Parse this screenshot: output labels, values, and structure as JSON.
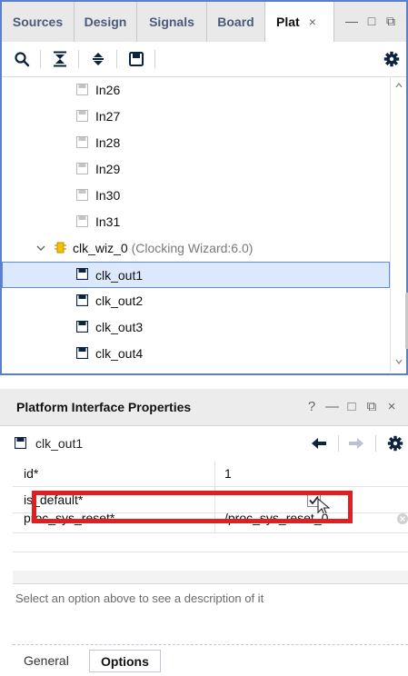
{
  "top_panel": {
    "tabs": [
      {
        "label": "Sources",
        "active": false
      },
      {
        "label": "Design",
        "active": false
      },
      {
        "label": "Signals",
        "active": false
      },
      {
        "label": "Board",
        "active": false
      },
      {
        "label": "Plat",
        "active": true
      }
    ],
    "tab_close_glyph": "×",
    "window_buttons": {
      "minimize": "—",
      "maximize": "□",
      "restore": "⧉"
    },
    "toolbar": {
      "icons": [
        "search-icon",
        "collapse-all-icon",
        "expand-all-icon",
        "save-icon",
        "settings-gear-icon"
      ]
    },
    "tree": {
      "rows": [
        {
          "label": "In26",
          "sublabel": "",
          "icon": "port-icon",
          "indent": 2,
          "selected": false
        },
        {
          "label": "In27",
          "sublabel": "",
          "icon": "port-icon",
          "indent": 2,
          "selected": false
        },
        {
          "label": "In28",
          "sublabel": "",
          "icon": "port-icon",
          "indent": 2,
          "selected": false
        },
        {
          "label": "In29",
          "sublabel": "",
          "icon": "port-icon",
          "indent": 2,
          "selected": false
        },
        {
          "label": "In30",
          "sublabel": "",
          "icon": "port-icon",
          "indent": 2,
          "selected": false
        },
        {
          "label": "In31",
          "sublabel": "",
          "icon": "port-icon",
          "indent": 2,
          "selected": false
        },
        {
          "label": "clk_wiz_0",
          "sublabel": "(Clocking Wizard:6.0)",
          "icon": "ip-block-icon",
          "indent": 1,
          "selected": false,
          "expanded": true
        },
        {
          "label": "clk_out1",
          "sublabel": "",
          "icon": "clock-port-icon",
          "indent": 2,
          "selected": true
        },
        {
          "label": "clk_out2",
          "sublabel": "",
          "icon": "clock-port-icon",
          "indent": 2,
          "selected": false
        },
        {
          "label": "clk_out3",
          "sublabel": "",
          "icon": "clock-port-icon",
          "indent": 2,
          "selected": false
        },
        {
          "label": "clk_out4",
          "sublabel": "",
          "icon": "clock-port-icon",
          "indent": 2,
          "selected": false
        }
      ]
    }
  },
  "bottom_panel": {
    "title": "Platform Interface Properties",
    "header_buttons": {
      "help": "?",
      "minimize": "—",
      "maximize": "□",
      "restore": "⧉",
      "close": "×"
    },
    "object": {
      "name": "clk_out1",
      "icon": "clock-port-icon"
    },
    "nav_icons": [
      "back-arrow-icon",
      "forward-arrow-icon",
      "settings-gear-icon"
    ],
    "properties": [
      {
        "name": "id*",
        "value": "1",
        "type": "text"
      },
      {
        "name": "is_default*",
        "value": "",
        "type": "checkbox",
        "checked": true
      },
      {
        "name": "proc_sys_reset*",
        "value": "/proc_sys_reset_0",
        "type": "text"
      }
    ],
    "description_text": "Select an option above to see a description of it",
    "tabs": [
      {
        "label": "General",
        "active": false
      },
      {
        "label": "Options",
        "active": true
      }
    ]
  },
  "colors": {
    "panel_border": "#5b7fcf",
    "selection_bg": "#dce8fb",
    "selection_border": "#5b8ed6",
    "highlight_box": "#e02020",
    "toolbar_icon": "#0c2340"
  }
}
